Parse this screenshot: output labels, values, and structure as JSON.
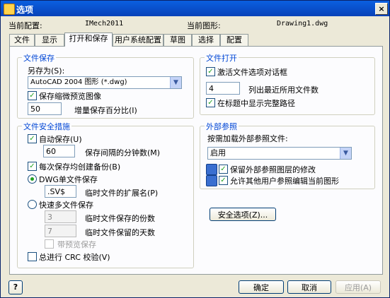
{
  "window": {
    "title": "选项",
    "close": "×"
  },
  "profile": {
    "current_config_label": "当前配置:",
    "current_config_value": "IMech2011",
    "current_drawing_label": "当前图形:",
    "current_drawing_value": "Drawing1.dwg"
  },
  "tabs": [
    "文件",
    "显示",
    "打开和保存",
    "用户系统配置",
    "草图",
    "选择",
    "配置"
  ],
  "file_save": {
    "title": "文件保存",
    "save_as_label": "另存为(S):",
    "save_as_value": "AutoCAD 2004 图形 (*.dwg)",
    "thumbnail_label": "保存缩微预览图像",
    "percent_value": "50",
    "percent_label": "增量保存百分比(I)"
  },
  "file_safety": {
    "title": "文件安全措施",
    "autosave_label": "自动保存(U)",
    "minutes_value": "60",
    "minutes_label": "保存间隔的分钟数(M)",
    "backup_label": "每次保存均创建备份(B)",
    "single_label": "DWG单文件保存",
    "ext_value": ".SV$",
    "ext_label": "临时文件的扩展名(P)",
    "multi_label": "快速多文件保存",
    "copies_value": "3",
    "copies_label": "临时文件保存的份数",
    "days_value": "7",
    "days_label": "临时文件保留的天数",
    "preview_label": "带预览保存",
    "crc_label": "总进行 CRC 校验(V)"
  },
  "file_open": {
    "title": "文件打开",
    "activate_label": "激活文件选项对话框",
    "recent_value": "4",
    "recent_label": "列出最近所用文件数",
    "fullpath_label": "在标题中显示完整路径"
  },
  "xref": {
    "title": "外部参照",
    "load_label": "按需加载外部参照文件:",
    "load_value": "启用",
    "retain_label": "保留外部参照图层的修改",
    "allow_label": "允许其他用户参照编辑当前图形"
  },
  "security_button": "安全选项(Z)...",
  "buttons": {
    "ok": "确定",
    "cancel": "取消",
    "apply": "应用(A)",
    "help": "?"
  }
}
